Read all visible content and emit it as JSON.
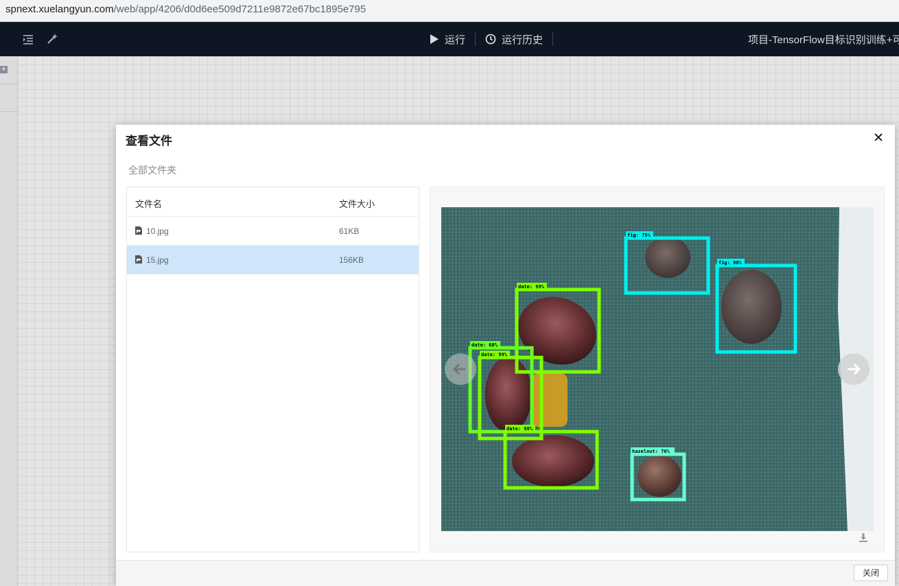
{
  "browser": {
    "url_host": "spnext.xuelangyun.com",
    "url_path": "/web/app/4206/d0d6ee509d7211e9872e67bc1895e795"
  },
  "appbar": {
    "run_label": "运行",
    "history_label": "运行历史",
    "project_title": "项目-TensorFlow目标识别训练+可"
  },
  "modal": {
    "title": "查看文件",
    "close_symbol": "✕",
    "breadcrumb": "全部文件夹",
    "table": {
      "columns": [
        "文件名",
        "文件大小"
      ],
      "rows": [
        {
          "name": "10.jpg",
          "size": "61KB",
          "selected": false
        },
        {
          "name": "15.jpg",
          "size": "156KB",
          "selected": true
        }
      ]
    },
    "preview": {
      "detections": [
        {
          "label": "fig: 75%",
          "color": "#00f0f0"
        },
        {
          "label": "fig: 90%",
          "color": "#00f0f0"
        },
        {
          "label": "date: 99%",
          "color": "#7fff00"
        },
        {
          "label": "date: 68%",
          "color": "#66ff22"
        },
        {
          "label": "date: 99%",
          "color": "#7fff00"
        },
        {
          "label": "date: 98%",
          "color": "#7fff00"
        },
        {
          "label": "hazelnut: 76%",
          "color": "#66ffd0"
        }
      ],
      "icons": {
        "prev": "arrow-left-icon",
        "next": "arrow-right-icon",
        "download": "download-icon"
      }
    },
    "footer": {
      "close_label": "关闭"
    }
  }
}
